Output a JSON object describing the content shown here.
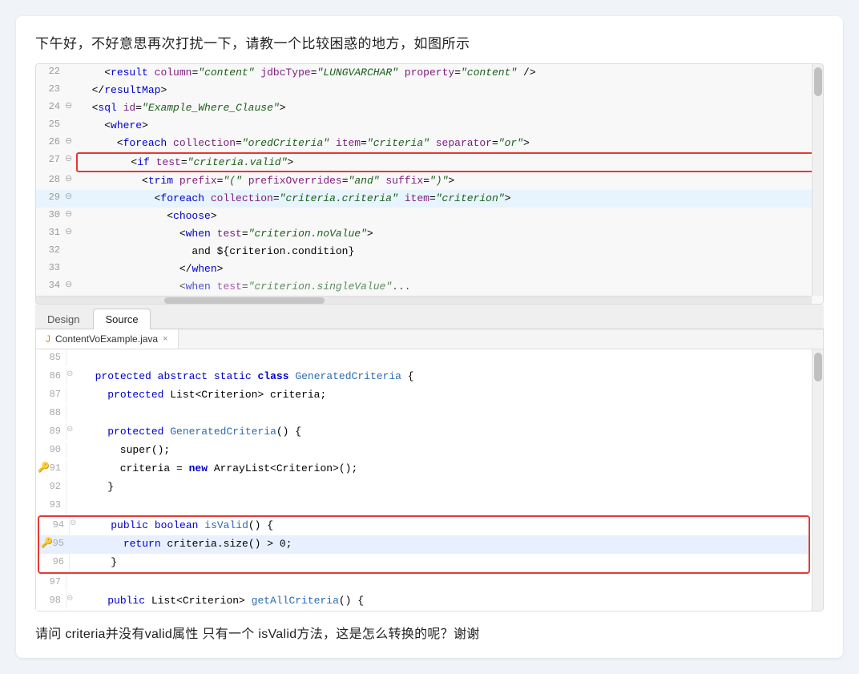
{
  "intro": {
    "text": "下午好，不好意思再次打扰一下，请教一个比较困惑的地方，如图所示"
  },
  "xml_code": {
    "lines": [
      {
        "num": "22",
        "fold": false,
        "indent": 2,
        "content_html": "    &lt;<span class='tag'>result</span> <span class='attr'>column</span>=<span class='attr-val'>&quot;content&quot;</span> <span class='attr'>jdbcType</span>=<span class='attr-val'>&quot;LUNGVARCHAR&quot;</span> <span class='attr'>property</span>=<span class='attr-val'>&quot;content&quot;</span> /&gt;"
      },
      {
        "num": "23",
        "fold": false,
        "indent": 1,
        "content_html": "  &lt;/<span class='tag'>resultMap</span>&gt;"
      },
      {
        "num": "24",
        "fold": true,
        "indent": 1,
        "content_html": "  &lt;<span class='tag'>sql</span> <span class='attr'>id</span>=<span class='attr-val'>&quot;Example_Where_Clause&quot;</span>&gt;"
      },
      {
        "num": "25",
        "fold": false,
        "indent": 2,
        "content_html": "    &lt;<span class='tag'>where</span>&gt;"
      },
      {
        "num": "26",
        "fold": true,
        "indent": 3,
        "content_html": "      &lt;<span class='tag'>foreach</span> <span class='attr'>collection</span>=<span class='attr-val'>&quot;oredCriteria&quot;</span> <span class='attr'>item</span>=<span class='attr-val'>&quot;criteria&quot;</span> <span class='attr'>separator</span>=<span class='attr-val'>&quot;or&quot;</span>&gt;"
      },
      {
        "num": "27",
        "fold": true,
        "indent": 4,
        "content_html": "        &lt;<span class='tag'>if</span> <span class='attr'>test</span>=<span class='attr-val'>&quot;criteria.valid&quot;</span>&gt;",
        "redBorder": true
      },
      {
        "num": "28",
        "fold": true,
        "indent": 5,
        "content_html": "          &lt;<span class='tag'>trim</span> <span class='attr'>prefix</span>=<span class='attr-val'>&quot;(&quot;</span> <span class='attr'>prefixOverrides</span>=<span class='attr-val'>&quot;and&quot;</span> <span class='attr'>suffix</span>=<span class='attr-val'>&quot;)&quot;</span>&gt;"
      },
      {
        "num": "29",
        "fold": true,
        "indent": 6,
        "content_html": "            &lt;<span class='tag'>foreach</span> <span class='attr'>collection</span>=<span class='attr-val'>&quot;criteria.criteria&quot;</span> <span class='attr'>item</span>=<span class='attr-val'>&quot;criterion&quot;</span>&gt;",
        "highlighted": true
      },
      {
        "num": "30",
        "fold": true,
        "indent": 7,
        "content_html": "              &lt;<span class='tag'>choose</span>&gt;"
      },
      {
        "num": "31",
        "fold": true,
        "indent": 8,
        "content_html": "                &lt;<span class='tag'>when</span> <span class='attr'>test</span>=<span class='attr-val'>&quot;criterion.noValue&quot;</span>&gt;"
      },
      {
        "num": "32",
        "fold": false,
        "indent": 9,
        "content_html": "                  and ${criterion.condition}"
      },
      {
        "num": "33",
        "fold": false,
        "indent": 8,
        "content_html": "                &lt;/<span class='tag'>when</span>&gt;"
      },
      {
        "num": "34",
        "fold": true,
        "indent": 8,
        "content_html": "                &lt;<span class='tag'>when</span> <span class='attr'>test</span>=<span class='attr-val'>&quot;criterion.singleValue&quot;</span>..."
      }
    ]
  },
  "tabs": {
    "design_label": "Design",
    "source_label": "Source",
    "active": "Source"
  },
  "java_file": {
    "filename": "ContentVoExample.java",
    "close_icon": "×",
    "lines": [
      {
        "num": "85",
        "fold": false,
        "content_html": "  <span class='comment'>85</span>"
      },
      {
        "num": "86",
        "fold": true,
        "content_html": "  <span class='kw-mod'>protected</span> <span class='kw-mod'>abstract</span> <span class='kw-mod'>static</span> <span class='kw'>class</span> <span class='class-name'>GeneratedCriteria</span> {"
      },
      {
        "num": "87",
        "fold": false,
        "content_html": "    <span class='kw-mod'>protected</span> List&lt;Criterion&gt; criteria;"
      },
      {
        "num": "88",
        "fold": false,
        "content_html": ""
      },
      {
        "num": "89",
        "fold": true,
        "content_html": "    <span class='kw-mod'>protected</span> <span class='class-name'>GeneratedCriteria</span>() {"
      },
      {
        "num": "90",
        "fold": false,
        "content_html": "      super();"
      },
      {
        "num": "91",
        "fold": false,
        "content_html": "      criteria = <span class='kw'>new</span> ArrayList&lt;Criterion&gt;();",
        "key": true
      },
      {
        "num": "92",
        "fold": false,
        "content_html": "    }"
      },
      {
        "num": "93",
        "fold": false,
        "content_html": ""
      },
      {
        "num": "94",
        "fold": true,
        "content_html": "    <span class='kw-mod'>public</span> <span class='kw-mod'>boolean</span> <span class='class-name'>isValid</span>() {",
        "redBorder_start": true
      },
      {
        "num": "95",
        "fold": false,
        "content_html": "      <span class='kw-mod'>return</span> criteria.size() &gt; 0;",
        "key": true,
        "highlighted": true
      },
      {
        "num": "96",
        "fold": false,
        "content_html": "    }",
        "redBorder_end": true
      },
      {
        "num": "97",
        "fold": false,
        "content_html": ""
      },
      {
        "num": "98",
        "fold": true,
        "content_html": "    <span class='kw-mod'>public</span> List&lt;Criterion&gt; <span class='class-name'>getAllCriteria</span>() {"
      }
    ]
  },
  "question": {
    "text": "请问 criteria并没有valid属性  只有一个 isValid方法，这是怎么转换的呢？谢谢"
  }
}
